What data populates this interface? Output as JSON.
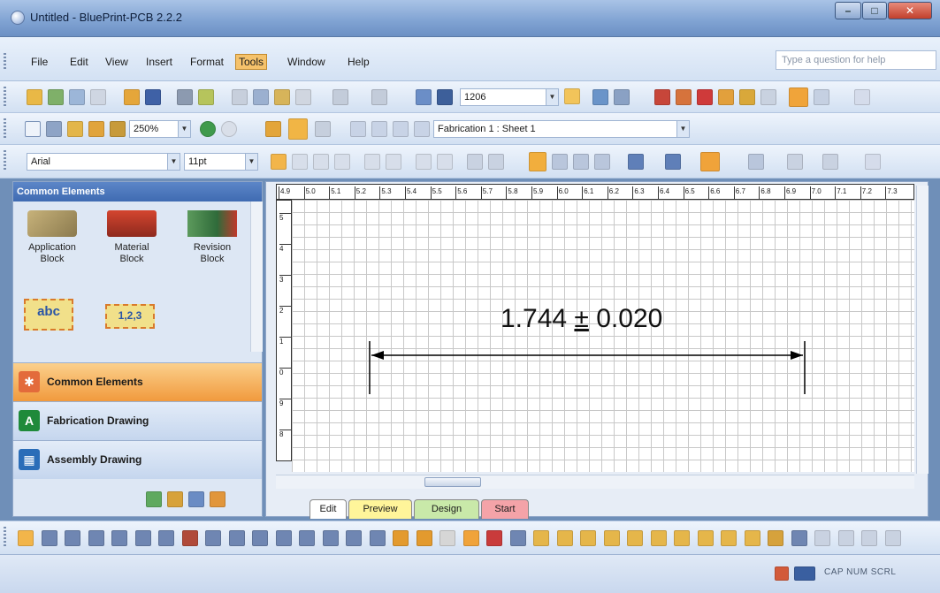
{
  "window": {
    "title": "Untitled - BluePrint-PCB 2.2.2"
  },
  "menu": {
    "items": [
      "File",
      "Edit",
      "View",
      "Insert",
      "Format",
      "Tools",
      "Window",
      "Help"
    ],
    "active": "Tools",
    "help_placeholder": "Type a question for help"
  },
  "toolbar1": {
    "text_field": "1206"
  },
  "toolbar2": {
    "zoom": "250%",
    "sheet": "Fabrication 1 : Sheet 1"
  },
  "toolbar3": {
    "font": "Arial",
    "size": "11pt"
  },
  "left_pane": {
    "header": "Common Elements",
    "stencils": [
      {
        "line1": "Application",
        "line2": "Block"
      },
      {
        "line1": "Material",
        "line2": "Block"
      },
      {
        "line1": "Revision",
        "line2": "Block"
      }
    ],
    "stencil_abc": "abc",
    "stencil_123": "1,2,3",
    "sections": [
      "Common Elements",
      "Fabrication Drawing",
      "Assembly Drawing"
    ],
    "section_icon_letter": "A"
  },
  "ruler": {
    "h_ticks": [
      "4.9",
      "5.0",
      "5.1",
      "5.2",
      "5.3",
      "5.4",
      "5.5",
      "5.6",
      "5.7",
      "5.8",
      "5.9",
      "6.0",
      "6.1",
      "6.2",
      "6.3",
      "6.4",
      "6.5",
      "6.6",
      "6.7",
      "6.8",
      "6.9",
      "7.0",
      "7.1",
      "7.2",
      "7.3"
    ],
    "v_ticks": [
      "5",
      "4",
      "3",
      "2",
      "1",
      "0",
      "9",
      "8"
    ]
  },
  "dimension": {
    "value": "1.744",
    "tolerance_symbol": "±",
    "tolerance": "0.020"
  },
  "tabs": [
    "Edit",
    "Preview",
    "Design",
    "Start"
  ],
  "tab_colors": [
    "#ffffff",
    "#fff59a",
    "#c9e9a9",
    "#f4a3a8"
  ],
  "status": {
    "indicators": "CAP  NUM  SCRL"
  }
}
